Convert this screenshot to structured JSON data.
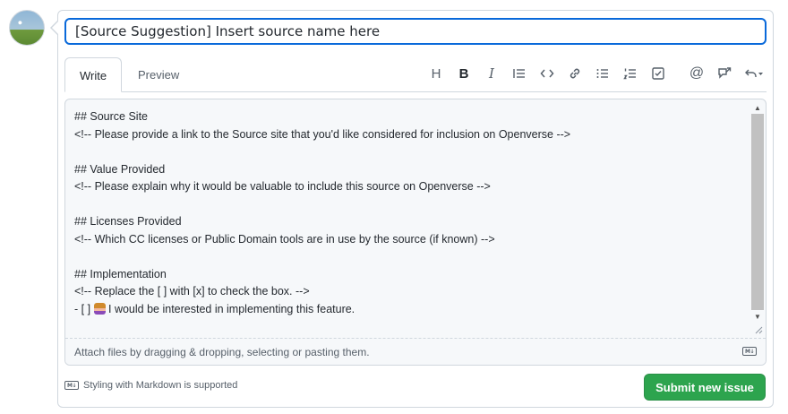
{
  "issue": {
    "title_value": "[Source Suggestion] Insert source name here"
  },
  "tabs": [
    {
      "label": "Write",
      "active": true
    },
    {
      "label": "Preview",
      "active": false
    }
  ],
  "toolbar": {
    "icons": [
      "heading-icon",
      "bold-icon",
      "italic-icon",
      "quote-icon",
      "code-icon",
      "link-icon",
      "unordered-list-icon",
      "ordered-list-icon",
      "task-list-icon",
      "mention-icon",
      "cross-reference-icon",
      "reply-icon"
    ],
    "heading": "H",
    "bold": "B",
    "italic": "I"
  },
  "editor": {
    "lines": [
      "## Source Site",
      "<!-- Please provide a link to the Source site that you'd like considered for inclusion on Openverse -->",
      "",
      "## Value Provided",
      "<!-- Please explain why it would be valuable to include this source on Openverse -->",
      "",
      "## Licenses Provided",
      "<!-- Which CC licenses or Public Domain tools are in use by the source (if known) -->",
      "",
      "## Implementation",
      "<!-- Replace the [ ] with [x] to check the box. -->"
    ],
    "last_line_prefix": "- [ ] ",
    "last_line_suffix": " I would be interested in implementing this feature.",
    "emoji": "raising-hand-emoji"
  },
  "attach": {
    "text": "Attach files by dragging & dropping, selecting or pasting them.",
    "md_badge": "M↓"
  },
  "footer": {
    "markdown_note": "Styling with Markdown is supported",
    "md_badge": "M↓"
  },
  "submit": {
    "label": "Submit new issue",
    "color": "#2da44e"
  }
}
